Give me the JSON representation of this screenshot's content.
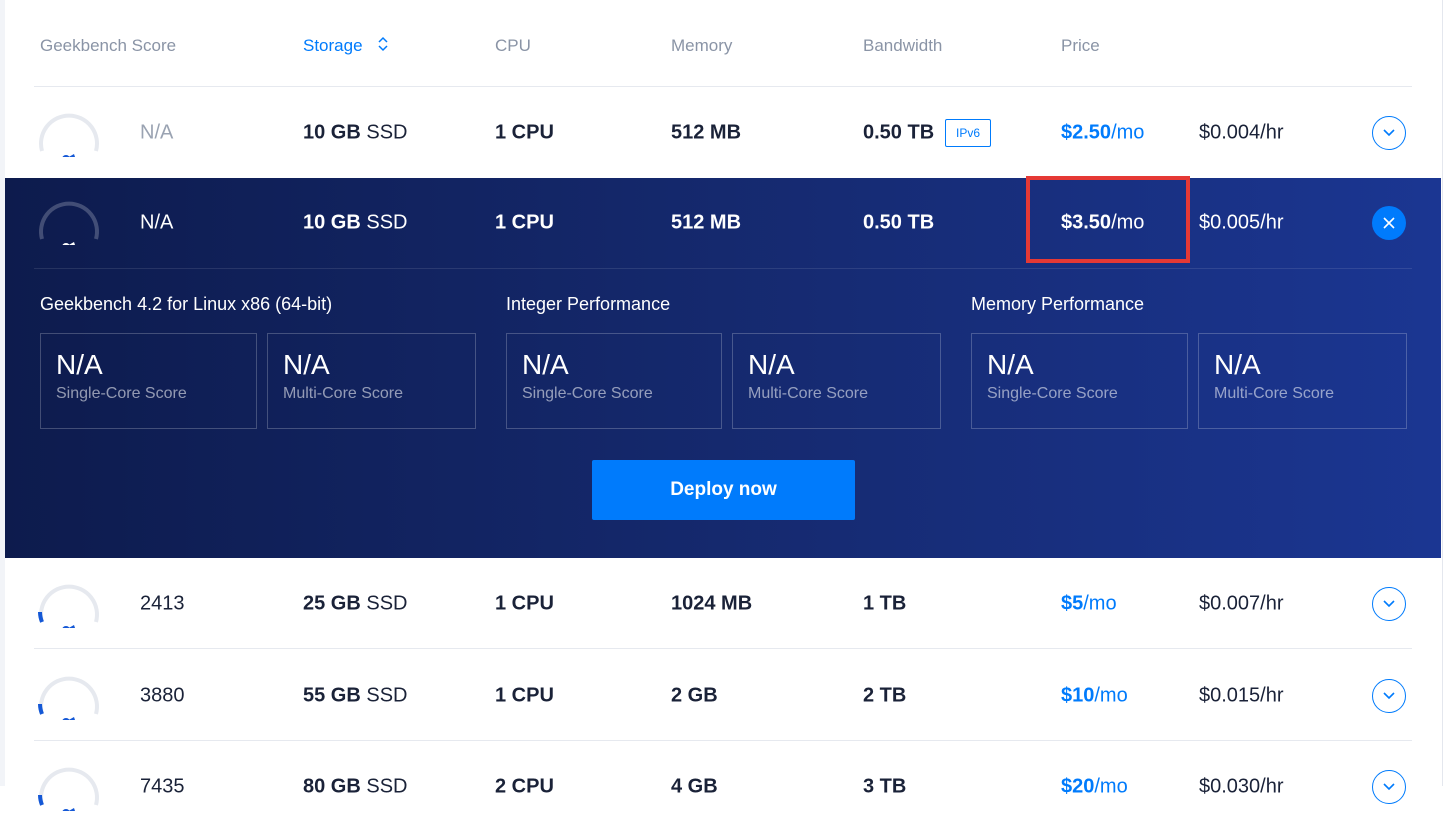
{
  "header": {
    "geekbench": "Geekbench Score",
    "storage": "Storage",
    "cpu": "CPU",
    "memory": "Memory",
    "bandwidth": "Bandwidth",
    "price": "Price"
  },
  "rows": [
    {
      "score": "N/A",
      "storage_amt": "10 GB",
      "storage_type": "SSD",
      "cpu": "1 CPU",
      "memory": "512 MB",
      "bandwidth": "0.50 TB",
      "badge": "IPv6",
      "price_amt": "$2.50",
      "price_unit": "/mo",
      "hourly": "$0.004/hr"
    },
    {
      "score": "N/A",
      "storage_amt": "10 GB",
      "storage_type": "SSD",
      "cpu": "1 CPU",
      "memory": "512 MB",
      "bandwidth": "0.50 TB",
      "price_amt": "$3.50",
      "price_unit": "/mo",
      "hourly": "$0.005/hr"
    },
    {
      "score": "2413",
      "storage_amt": "25 GB",
      "storage_type": "SSD",
      "cpu": "1 CPU",
      "memory": "1024 MB",
      "bandwidth": "1 TB",
      "price_amt": "$5",
      "price_unit": "/mo",
      "hourly": "$0.007/hr"
    },
    {
      "score": "3880",
      "storage_amt": "55 GB",
      "storage_type": "SSD",
      "cpu": "1 CPU",
      "memory": "2 GB",
      "bandwidth": "2 TB",
      "price_amt": "$10",
      "price_unit": "/mo",
      "hourly": "$0.015/hr"
    },
    {
      "score": "7435",
      "storage_amt": "80 GB",
      "storage_type": "SSD",
      "cpu": "2 CPU",
      "memory": "4 GB",
      "bandwidth": "3 TB",
      "price_amt": "$20",
      "price_unit": "/mo",
      "hourly": "$0.030/hr"
    }
  ],
  "benchmarks": {
    "groups": [
      {
        "title": "Geekbench 4.2 for Linux x86 (64-bit)",
        "single_value": "N/A",
        "single_label": "Single-Core Score",
        "multi_value": "N/A",
        "multi_label": "Multi-Core Score"
      },
      {
        "title": "Integer Performance",
        "single_value": "N/A",
        "single_label": "Single-Core Score",
        "multi_value": "N/A",
        "multi_label": "Multi-Core Score"
      },
      {
        "title": "Memory Performance",
        "single_value": "N/A",
        "single_label": "Single-Core Score",
        "multi_value": "N/A",
        "multi_label": "Multi-Core Score"
      }
    ],
    "deploy_label": "Deploy now"
  },
  "colors": {
    "accent": "#007bfc",
    "panel": "#15296e",
    "highlight": "#e53935"
  },
  "icons": {
    "sort": "sort-updown-icon",
    "expand": "chevron-down-icon",
    "close": "close-icon",
    "gauge": "speed-gauge-icon"
  }
}
